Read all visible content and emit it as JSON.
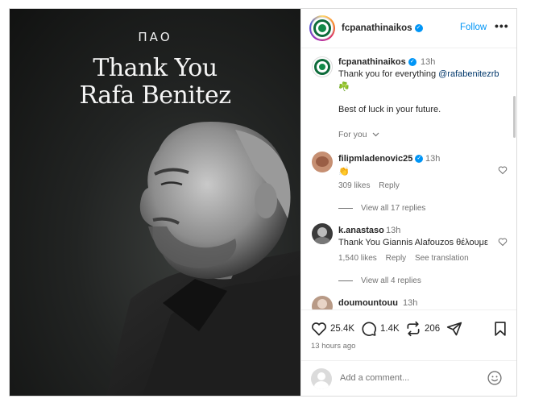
{
  "post_image": {
    "brand": "ΠΑΟ",
    "headline_line1": "Thank You",
    "headline_line2": "Rafa Benitez"
  },
  "header": {
    "username": "fcpanathinaikos",
    "follow_label": "Follow",
    "more_label": "•••"
  },
  "caption": {
    "username": "fcpanathinaikos",
    "time": "13h",
    "text_prefix": "Thank you for everything ",
    "mention": "@rafabenitezrb",
    "emoji": "☘️",
    "text2": "Best of luck in your future.",
    "for_you_label": "For you"
  },
  "comments": [
    {
      "username": "filipmladenovic25",
      "verified": true,
      "time": "13h",
      "text": "👏",
      "likes": "309 likes",
      "reply_label": "Reply",
      "view_replies": "View all 17 replies"
    },
    {
      "username": "k.anastaso",
      "verified": false,
      "time": "13h",
      "text": "Thank You Giannis Alafouzos θέλουμε",
      "likes": "1,540 likes",
      "reply_label": "Reply",
      "translation_label": "See translation",
      "view_replies": "View all 4 replies"
    },
    {
      "username": "doumountouu",
      "verified": false,
      "time": "13h"
    }
  ],
  "actions": {
    "likes_count": "25.4K",
    "comments_count": "1.4K",
    "reposts_count": "206",
    "posted_ago": "13 hours ago"
  },
  "add_comment": {
    "placeholder": "Add a comment..."
  },
  "colors": {
    "accent": "#0095f6",
    "club_green": "#0d6b3a",
    "text": "#262626",
    "muted": "#737373"
  }
}
